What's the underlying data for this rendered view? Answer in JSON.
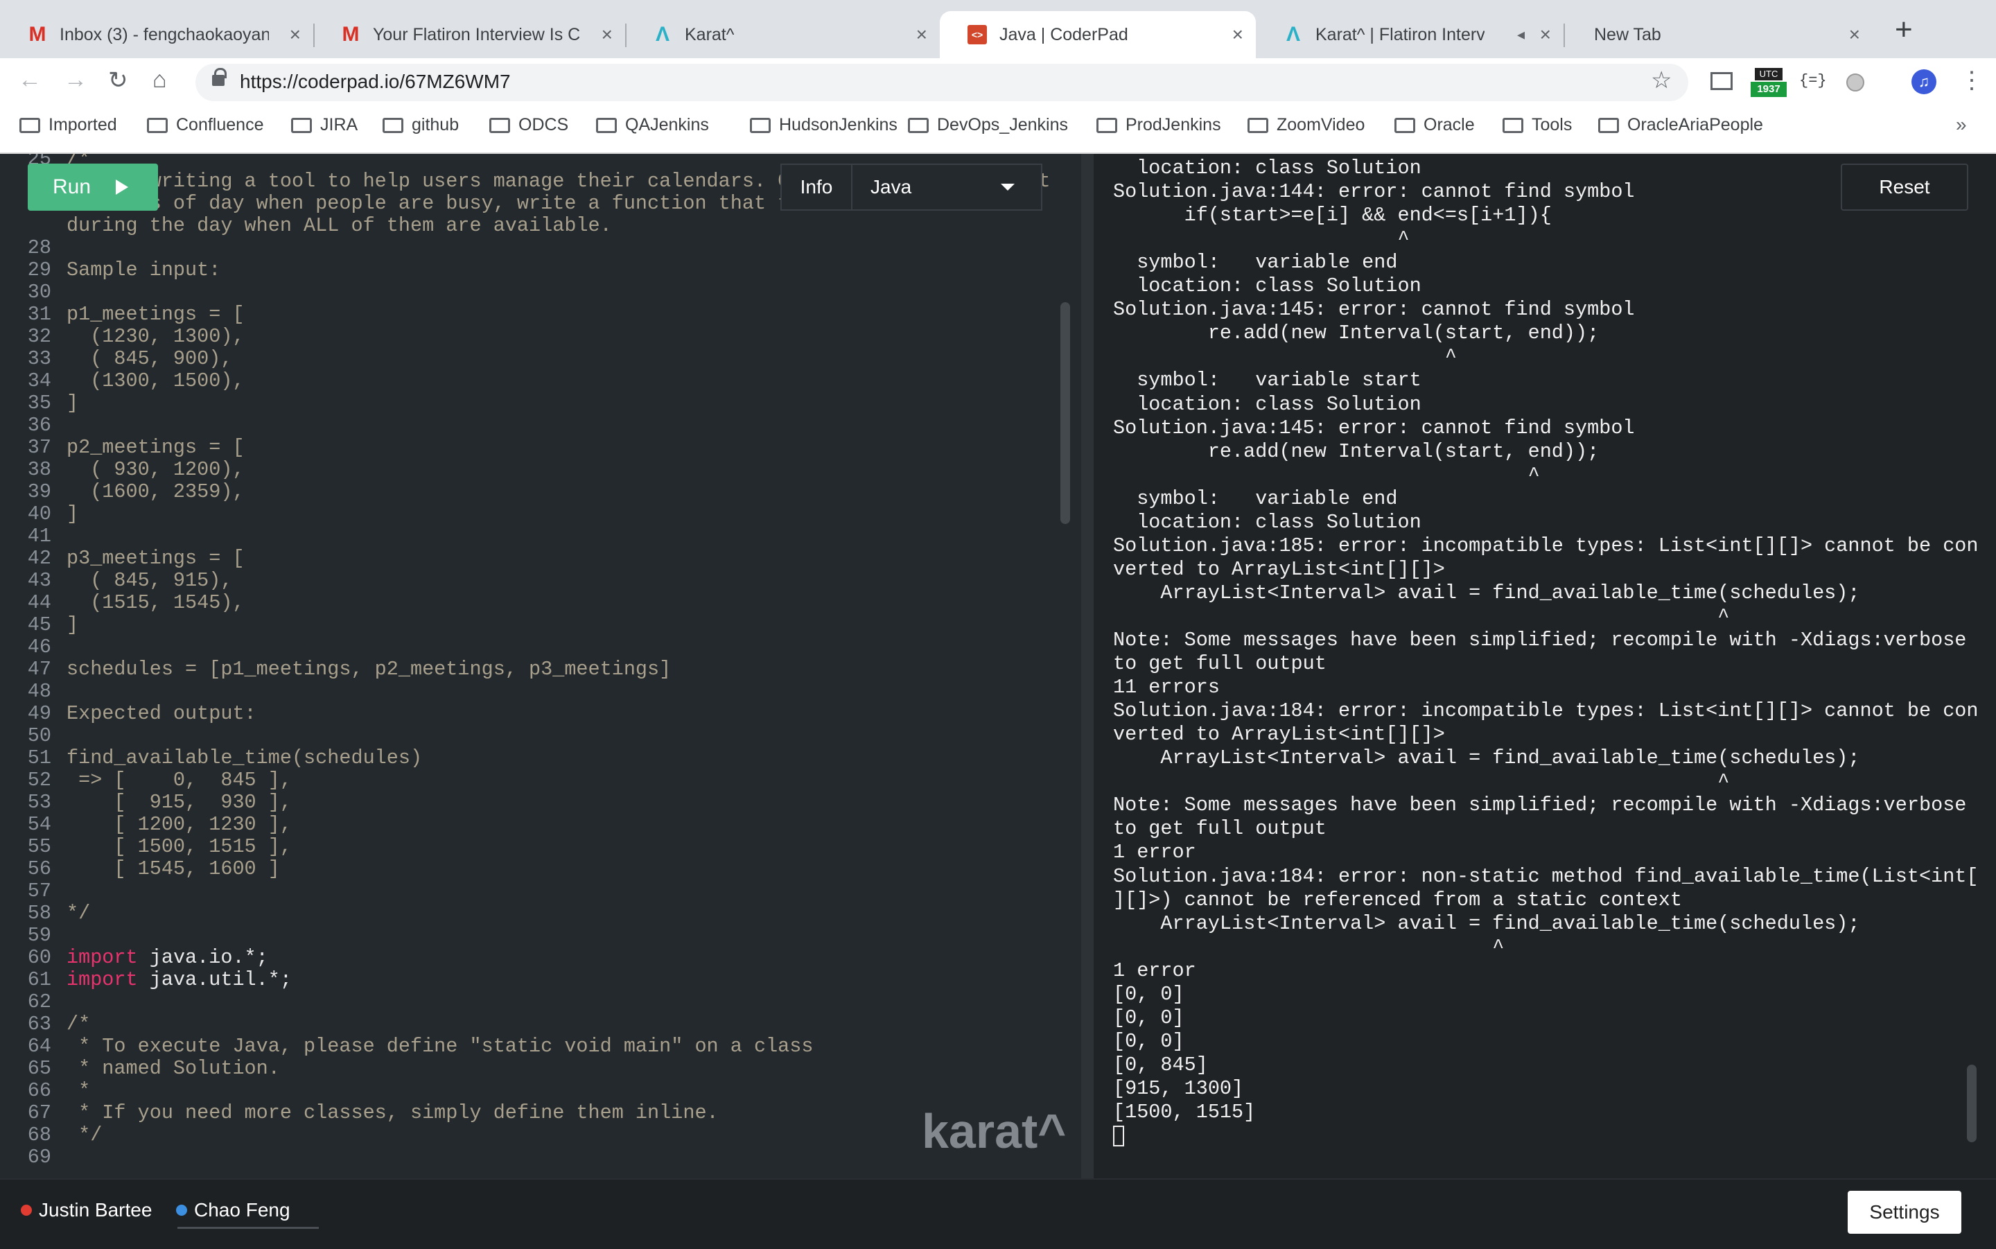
{
  "browser": {
    "tabs": [
      {
        "title": "Inbox (3) - fengchaokaoyan@",
        "icon": "gmail-icon",
        "left": 0
      },
      {
        "title": "Your Flatiron Interview Is Co",
        "icon": "gmail-icon"
      },
      {
        "title": "Karat^",
        "icon": "karat-icon"
      },
      {
        "title": "Java | CoderPad",
        "icon": "coderpad-icon",
        "active": true
      },
      {
        "title": "Karat^ | Flatiron Intervie",
        "icon": "karat-icon",
        "muted_icon": "speaker-mute-icon"
      },
      {
        "title": "New Tab",
        "icon": ""
      }
    ],
    "new_tab": "+",
    "url": "https://coderpad.io/67MZ6WM7",
    "extension_badge": "1937",
    "extension_badge_top": "UTC",
    "bookmarks": [
      "Imported",
      "Confluence",
      "JIRA",
      "github",
      "ODCS",
      "QAJenkins",
      "HudsonJenkins",
      "DevOps_Jenkins",
      "ProdJenkins",
      "ZoomVideo",
      "Oracle",
      "Tools",
      "OracleAriaPeople"
    ],
    "bookmarks_overflow": "»"
  },
  "editor": {
    "run_label": "Run",
    "info_label": "Info",
    "language": "Java",
    "watermark": "karat^",
    "lines": [
      {
        "n": "25",
        "t": "/*",
        "k": ""
      },
      {
        "n": "",
        "t": "We are writing a tool to help users manage their calendars. Given an unordered list",
        "k": ""
      },
      {
        "n": "",
        "t": "of times of day when people are busy, write a function that tells us the intervals",
        "k": ""
      },
      {
        "n": "",
        "t": "during the day when ALL of them are available.",
        "k": ""
      },
      {
        "n": "28",
        "t": "",
        "k": ""
      },
      {
        "n": "29",
        "t": "Sample input:",
        "k": ""
      },
      {
        "n": "30",
        "t": "",
        "k": ""
      },
      {
        "n": "31",
        "t": "p1_meetings = [",
        "k": ""
      },
      {
        "n": "32",
        "t": "  (1230, 1300),",
        "k": ""
      },
      {
        "n": "33",
        "t": "  ( 845, 900),",
        "k": ""
      },
      {
        "n": "34",
        "t": "  (1300, 1500),",
        "k": ""
      },
      {
        "n": "35",
        "t": "]",
        "k": ""
      },
      {
        "n": "36",
        "t": "",
        "k": ""
      },
      {
        "n": "37",
        "t": "p2_meetings = [",
        "k": ""
      },
      {
        "n": "38",
        "t": "  ( 930, 1200),",
        "k": ""
      },
      {
        "n": "39",
        "t": "  (1600, 2359),",
        "k": ""
      },
      {
        "n": "40",
        "t": "]",
        "k": ""
      },
      {
        "n": "41",
        "t": "",
        "k": ""
      },
      {
        "n": "42",
        "t": "p3_meetings = [",
        "k": ""
      },
      {
        "n": "43",
        "t": "  ( 845, 915),",
        "k": ""
      },
      {
        "n": "44",
        "t": "  (1515, 1545),",
        "k": ""
      },
      {
        "n": "45",
        "t": "]",
        "k": ""
      },
      {
        "n": "46",
        "t": "",
        "k": ""
      },
      {
        "n": "47",
        "t": "schedules = [p1_meetings, p2_meetings, p3_meetings]",
        "k": ""
      },
      {
        "n": "48",
        "t": "",
        "k": ""
      },
      {
        "n": "49",
        "t": "Expected output:",
        "k": ""
      },
      {
        "n": "50",
        "t": "",
        "k": ""
      },
      {
        "n": "51",
        "t": "find_available_time(schedules)",
        "k": ""
      },
      {
        "n": "52",
        "t": " => [    0,  845 ],",
        "k": ""
      },
      {
        "n": "53",
        "t": "    [  915,  930 ],",
        "k": ""
      },
      {
        "n": "54",
        "t": "    [ 1200, 1230 ],",
        "k": ""
      },
      {
        "n": "55",
        "t": "    [ 1500, 1515 ],",
        "k": ""
      },
      {
        "n": "56",
        "t": "    [ 1545, 1600 ]",
        "k": ""
      },
      {
        "n": "57",
        "t": "",
        "k": ""
      },
      {
        "n": "58",
        "t": "*/",
        "k": ""
      },
      {
        "n": "59",
        "t": "",
        "k": ""
      },
      {
        "n": "60",
        "t": "java.io.*;",
        "k": "import"
      },
      {
        "n": "61",
        "t": "java.util.*;",
        "k": "import"
      },
      {
        "n": "62",
        "t": "",
        "k": ""
      },
      {
        "n": "63",
        "t": "/*",
        "k": ""
      },
      {
        "n": "64",
        "t": " * To execute Java, please define \"static void main\" on a class",
        "k": ""
      },
      {
        "n": "65",
        "t": " * named Solution.",
        "k": ""
      },
      {
        "n": "66",
        "t": " *",
        "k": ""
      },
      {
        "n": "67",
        "t": " * If you need more classes, simply define them inline.",
        "k": ""
      },
      {
        "n": "68",
        "t": " */",
        "k": ""
      },
      {
        "n": "69",
        "t": "",
        "k": ""
      }
    ]
  },
  "output": {
    "reset_label": "Reset",
    "lines": [
      "  location: class Solution",
      "Solution.java:144: error: cannot find symbol",
      "      if(start>=e[i] && end<=s[i+1]){",
      "                        ^",
      "  symbol:   variable end",
      "  location: class Solution",
      "Solution.java:145: error: cannot find symbol",
      "        re.add(new Interval(start, end));",
      "                            ^",
      "  symbol:   variable start",
      "  location: class Solution",
      "Solution.java:145: error: cannot find symbol",
      "        re.add(new Interval(start, end));",
      "                                   ^",
      "  symbol:   variable end",
      "  location: class Solution",
      "Solution.java:185: error: incompatible types: List<int[][]> cannot be con",
      "verted to ArrayList<int[][]>",
      "    ArrayList<Interval> avail = find_available_time(schedules);",
      "                                                   ^",
      "Note: Some messages have been simplified; recompile with -Xdiags:verbose",
      "to get full output",
      "11 errors",
      "Solution.java:184: error: incompatible types: List<int[][]> cannot be con",
      "verted to ArrayList<int[][]>",
      "    ArrayList<Interval> avail = find_available_time(schedules);",
      "                                                   ^",
      "Note: Some messages have been simplified; recompile with -Xdiags:verbose",
      "to get full output",
      "1 error",
      "Solution.java:184: error: non-static method find_available_time(List<int[",
      "][]>) cannot be referenced from a static context",
      "    ArrayList<Interval> avail = find_available_time(schedules);",
      "                                ^",
      "1 error",
      "[0, 0]",
      "[0, 0]",
      "[0, 0]",
      "[0, 845]",
      "[915, 1300]",
      "[1500, 1515]"
    ]
  },
  "footer": {
    "users": [
      {
        "name": "Justin Bartee",
        "color": "#e03c31"
      },
      {
        "name": "Chao Feng",
        "color": "#3c8fe0"
      }
    ],
    "settings_label": "Settings"
  }
}
